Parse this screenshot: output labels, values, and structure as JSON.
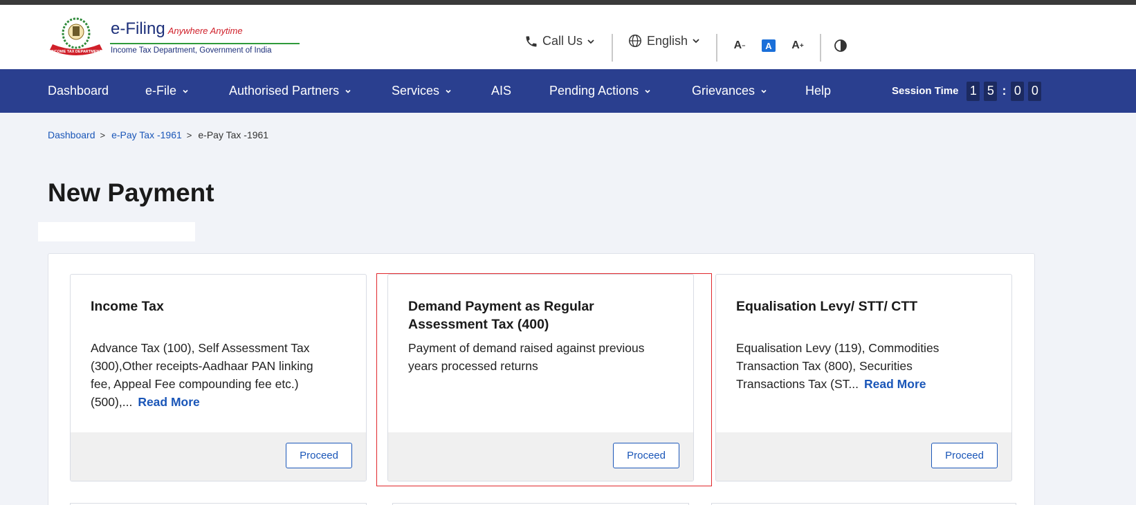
{
  "header": {
    "brand_title": "e-Filing",
    "brand_tagline": "Anywhere Anytime",
    "brand_subtitle": "Income Tax Department, Government of India",
    "emblem_text": "INCOME TAX DEPARTMENT",
    "call_us": "Call Us",
    "language": "English",
    "font_decrease": "A",
    "font_normal": "A",
    "font_increase": "A"
  },
  "nav": {
    "items": [
      {
        "label": "Dashboard"
      },
      {
        "label": "e-File"
      },
      {
        "label": "Authorised Partners"
      },
      {
        "label": "Services"
      },
      {
        "label": "AIS"
      },
      {
        "label": "Pending Actions"
      },
      {
        "label": "Grievances"
      },
      {
        "label": "Help"
      }
    ],
    "session_label": "Session Time",
    "session_digits": [
      "1",
      "5",
      "0",
      "0"
    ],
    "session_colon": ":"
  },
  "breadcrumb": {
    "items": [
      "Dashboard",
      "e-Pay Tax -1961"
    ],
    "current": "e-Pay Tax -1961",
    "separator": ">"
  },
  "page": {
    "title": "New Payment"
  },
  "cards": [
    {
      "title": "Income Tax",
      "description": "Advance Tax (100), Self Assessment Tax (300),Other receipts-Aadhaar PAN linking fee, Appeal Fee compounding fee etc.) (500),...",
      "read_more": "Read More",
      "button": "Proceed"
    },
    {
      "title": "Demand Payment as Regular Assessment Tax (400)",
      "description": "Payment of demand raised against previous years processed returns",
      "button": "Proceed"
    },
    {
      "title": "Equalisation Levy/ STT/ CTT",
      "description": "Equalisation Levy (119), Commodities Transaction Tax (800), Securities Transactions Tax (ST...",
      "read_more": "Read More",
      "button": "Proceed"
    }
  ],
  "colors": {
    "nav_bg": "#2a3f8f",
    "link": "#1a56b8",
    "highlight": "#e0262b",
    "page_bg": "#f1f3f8"
  }
}
